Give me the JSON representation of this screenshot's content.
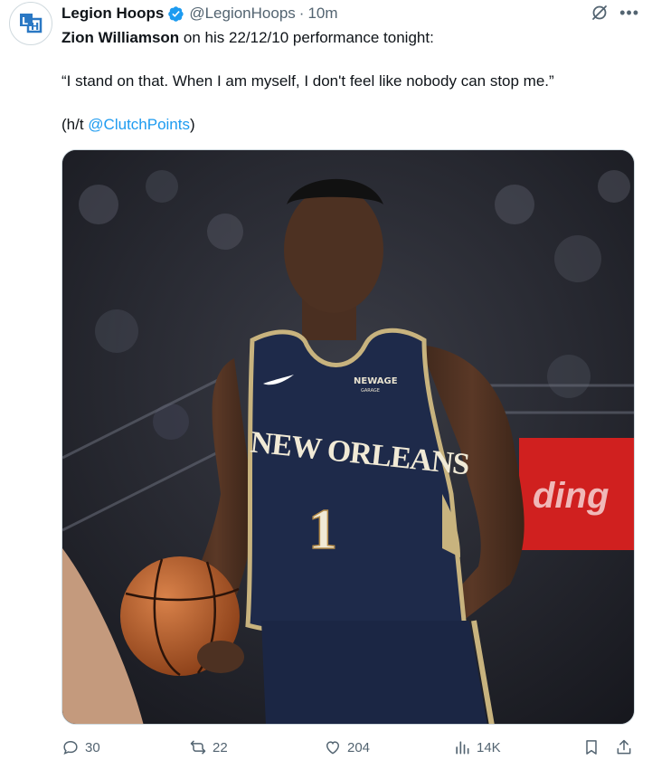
{
  "author": {
    "display_name": "Legion Hoops",
    "handle": "@LegionHoops",
    "separator": "·",
    "time": "10m",
    "avatar_icon": "legion-hoops-logo",
    "verified_icon": "verified-badge-icon"
  },
  "tweet": {
    "line1_bold": "Zion Williamson",
    "line1_rest": " on his 22/12/10 performance tonight:",
    "quote": "“I stand on that. When I am myself, I don't feel like nobody can stop me.”",
    "hat_tip_prefix": "(h/t ",
    "hat_tip_link": "@ClutchPoints",
    "hat_tip_suffix": ")"
  },
  "media": {
    "jersey_city": "NEW ORLEANS",
    "jersey_number": "1",
    "sponsor": "NEWAGE",
    "sponsor_sub": "GARAGE",
    "banner_text": "ding"
  },
  "engagement": {
    "replies": "30",
    "retweets": "22",
    "likes": "204",
    "views": "14K"
  },
  "colors": {
    "accent": "#1d9bf0",
    "muted": "#536471",
    "jersey_navy": "#1e2a4a",
    "jersey_gold": "#c8b37e"
  }
}
